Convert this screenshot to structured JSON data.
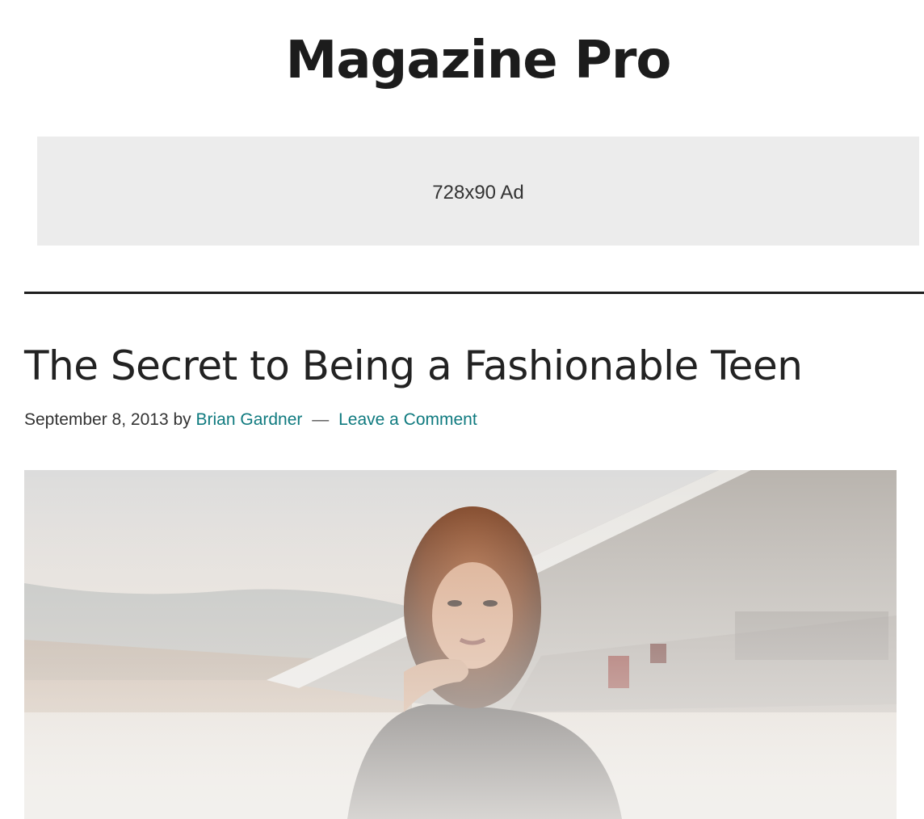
{
  "site": {
    "title": "Magazine Pro"
  },
  "ad": {
    "label": "728x90 Ad"
  },
  "post": {
    "title": "The Secret to Being a Fashionable Teen",
    "date": "September 8, 2013",
    "by_text": "by",
    "author": "Brian Gardner",
    "separator": "—",
    "comments_link": "Leave a Comment"
  },
  "colors": {
    "link": "#0f7a7f",
    "title": "#1c1c1c",
    "ad_background": "#ececec",
    "rule": "#1e1e1e"
  },
  "featured_image": {
    "description_icon": "photo-woman-portrait"
  }
}
